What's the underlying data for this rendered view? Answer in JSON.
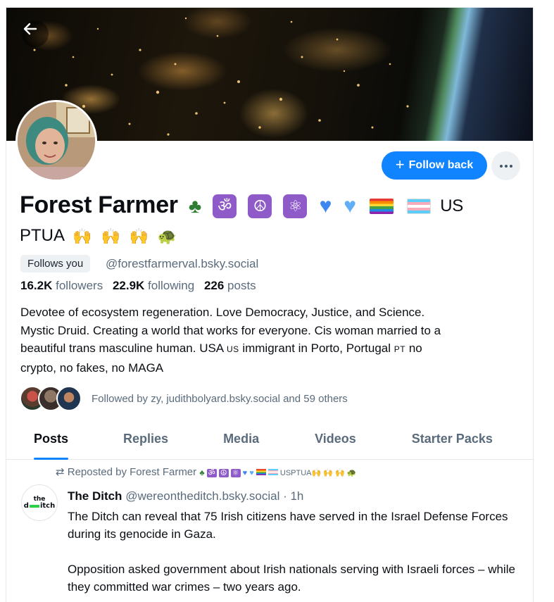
{
  "profile": {
    "name_main": "Forest Farmer",
    "name_us": "US",
    "name_line2_text": "PTUA",
    "follow_back_label": "Follow back",
    "follows_you_badge": "Follows you",
    "handle": "@forestfarmerval.bsky.social",
    "followers_count": "16.2K",
    "followers_label": "followers",
    "following_count": "22.9K",
    "following_label": "following",
    "posts_count": "226",
    "posts_label": "posts",
    "bio": {
      "line1": "Devotee of ecosystem regeneration. Love Democracy, Justice, and Science.",
      "line2": "Mystic Druid. Creating a world that works for everyone. Cis woman married to a",
      "line3a": "beautiful trans masculine human. USA ",
      "line3_us": "US",
      "line3b": " immigrant in Porto, Portugal ",
      "line3_pt": "PT",
      "line3c": " no",
      "line4": "crypto, no fakes, no MAGA"
    },
    "followed_by": "Followed by zy, judithbolyard.bsky.social and 59 others"
  },
  "tabs": [
    "Posts",
    "Replies",
    "Media",
    "Videos",
    "Starter Packs"
  ],
  "post": {
    "repost_label": "Reposted by Forest Farmer",
    "repost_suffix": "USPTUA",
    "author_name": "The Ditch",
    "author_handle": "@wereontheditch.bsky.social",
    "time": "· 1h",
    "avatar_top": "the",
    "avatar_left": "d",
    "avatar_right": "itch",
    "paragraph1": "The Ditch can reveal that 75 Irish citizens have served in the Israel Defense Forces during its genocide in Gaza.",
    "paragraph2": "Opposition asked government about Irish nationals serving with Israeli forces – while they committed war crimes – two years ago."
  },
  "icons": [
    "back-arrow-icon",
    "plus-icon",
    "more-dots-icon",
    "repost-icon",
    "tree-emoji",
    "om-emoji",
    "peace-emoji",
    "atom-emoji",
    "blue-heart-emoji",
    "light-blue-heart-emoji",
    "rainbow-flag-emoji",
    "trans-flag-emoji",
    "raised-hands-emoji",
    "turtle-emoji"
  ],
  "colors": {
    "accent": "#1083fe",
    "muted": "#5a6b7c",
    "text": "#0b0f14",
    "emoji_square": "#8e5bc8"
  }
}
